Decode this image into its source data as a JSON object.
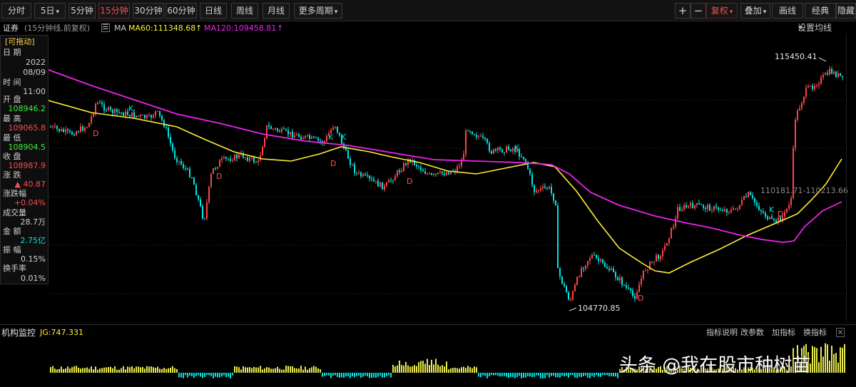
{
  "toolbar": {
    "periods": [
      "分时",
      "5日",
      "5分钟",
      "15分钟",
      "30分钟",
      "60分钟",
      "日线",
      "周线",
      "月线",
      "更多周期"
    ],
    "active_period": "15分钟",
    "right_buttons": [
      "+",
      "−",
      "复权",
      "叠加",
      "画线",
      "经典",
      "隐藏"
    ]
  },
  "info": {
    "name": "证券",
    "sub": "(15分钟线,前复权)",
    "ma_label": "MA",
    "ma60": "MA60:111348.68",
    "ma120": "MA120:109458.81",
    "up_arrow": "↑",
    "settings": "设置均线"
  },
  "panel": {
    "drag": "[可拖动]",
    "date_label": "日  期",
    "year": "2022",
    "date": "08/09",
    "time_label": "时  间",
    "time": "11:00",
    "open_label": "开  盘",
    "open": "108946.2",
    "high_label": "最  高",
    "high": "109065.8",
    "low_label": "最  低",
    "low": "108904.5",
    "close_label": "收  盘",
    "close": "108987.9",
    "chg_label": "涨  跌",
    "chg": "▲ 40.87",
    "pct_label": "涨跌幅",
    "pct": "+0.04%",
    "vol_label": "成交量",
    "vol": "28.7万",
    "amt_label": "金  额",
    "amt": "2.75亿",
    "amp_label": "振  幅",
    "amp": "0.15%",
    "turn_label": "换手率",
    "turn": "0.01%"
  },
  "chart": {
    "high_label": "115450.41",
    "low_label": "104770.85",
    "range_label": "110181.71-110213.66",
    "k": "K",
    "d": "D"
  },
  "indicator": {
    "name": "机构监控",
    "jg": "JG:747.331",
    "links": [
      "指标说明",
      "改参数",
      "加指标",
      "换指标"
    ]
  },
  "watermark": "头条 @我在股市种树苗",
  "colors": {
    "up": "#ff4444",
    "down": "#00e5e5",
    "ma60": "#ffee33",
    "ma120": "#ee22ee",
    "volume_up": "#e8e84a"
  }
}
